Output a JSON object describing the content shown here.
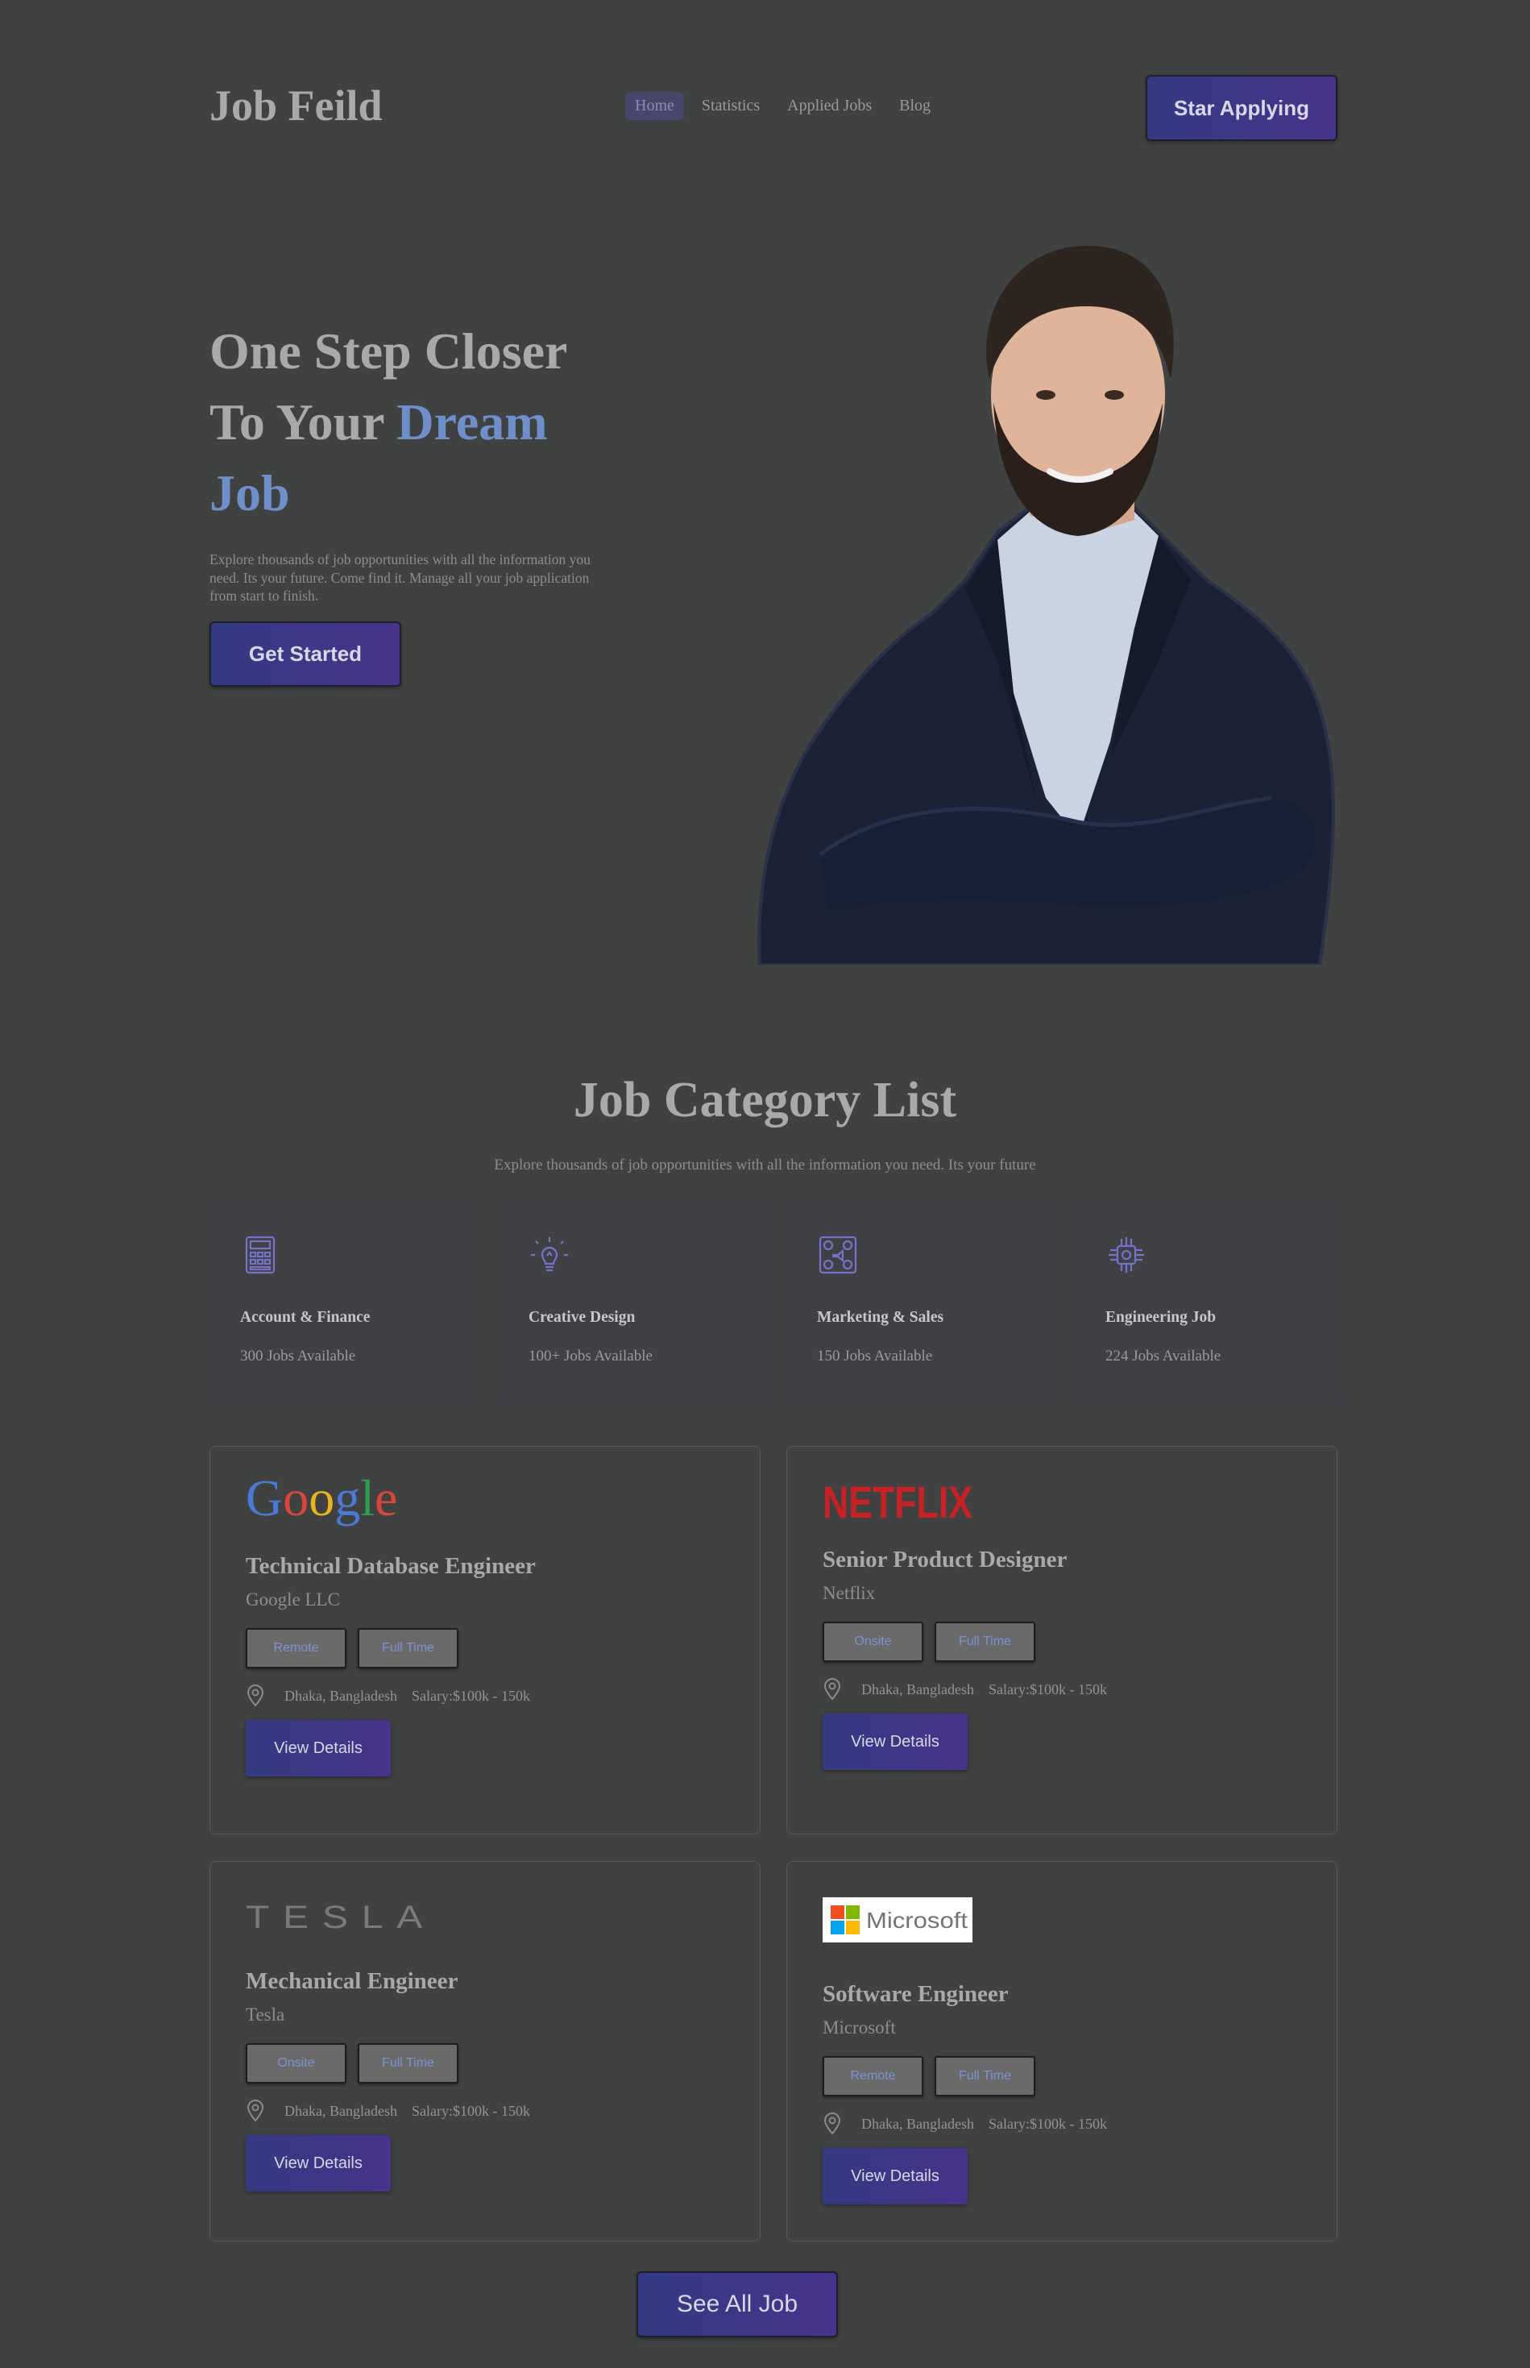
{
  "header": {
    "brand": "Job Feild",
    "nav": [
      "Home",
      "Statistics",
      "Applied Jobs",
      "Blog"
    ],
    "cta": "Star Applying"
  },
  "hero": {
    "title_line1": "One Step Closer",
    "title_line2_plain": "To Your ",
    "title_line2_accent": "Dream",
    "title_line3_accent": "Job",
    "description": "Explore thousands of job opportunities with all the information you need. Its your future. Come find it. Manage all your job application from start to finish.",
    "button": "Get Started",
    "colors": {
      "accent": "#6f8fca",
      "button_from": "#343a82",
      "button_to": "#47338a"
    }
  },
  "categories": {
    "title": "Job Category List",
    "subtitle": "Explore thousands of job opportunities with all the information you need. Its your future",
    "items": [
      {
        "icon": "calculator-icon",
        "title": "Account & Finance",
        "count": "300 Jobs Available"
      },
      {
        "icon": "lightbulb-icon",
        "title": "Creative Design",
        "count": "100+ Jobs Available"
      },
      {
        "icon": "marketing-icon",
        "title": "Marketing & Sales",
        "count": "150 Jobs Available"
      },
      {
        "icon": "chip-icon",
        "title": "Engineering Job",
        "count": "224 Jobs Available"
      }
    ]
  },
  "jobs": [
    {
      "logo": "Google",
      "title": "Technical Database Engineer",
      "company": "Google LLC",
      "tags": [
        "Remote",
        "Full Time"
      ],
      "location": "Dhaka, Bangladesh",
      "salary": "Salary:$100k - 150k",
      "button": "View Details"
    },
    {
      "logo": "NETFLIX",
      "title": "Senior Product Designer",
      "company": "Netflix",
      "tags": [
        "Onsite",
        "Full Time"
      ],
      "location": "Dhaka, Bangladesh",
      "salary": "Salary:$100k - 150k",
      "button": "View Details"
    },
    {
      "logo": "TESLA",
      "title": "Mechanical Engineer",
      "company": "Tesla",
      "tags": [
        "Onsite",
        "Full Time"
      ],
      "location": "Dhaka, Bangladesh",
      "salary": "Salary:$100k - 150k",
      "button": "View Details"
    },
    {
      "logo": "Microsoft",
      "title": "Software Engineer",
      "company": "Microsoft",
      "tags": [
        "Remote",
        "Full Time"
      ],
      "location": "Dhaka, Bangladesh",
      "salary": "Salary:$100k - 150k",
      "button": "View Details"
    }
  ],
  "see_all": "See All Job"
}
